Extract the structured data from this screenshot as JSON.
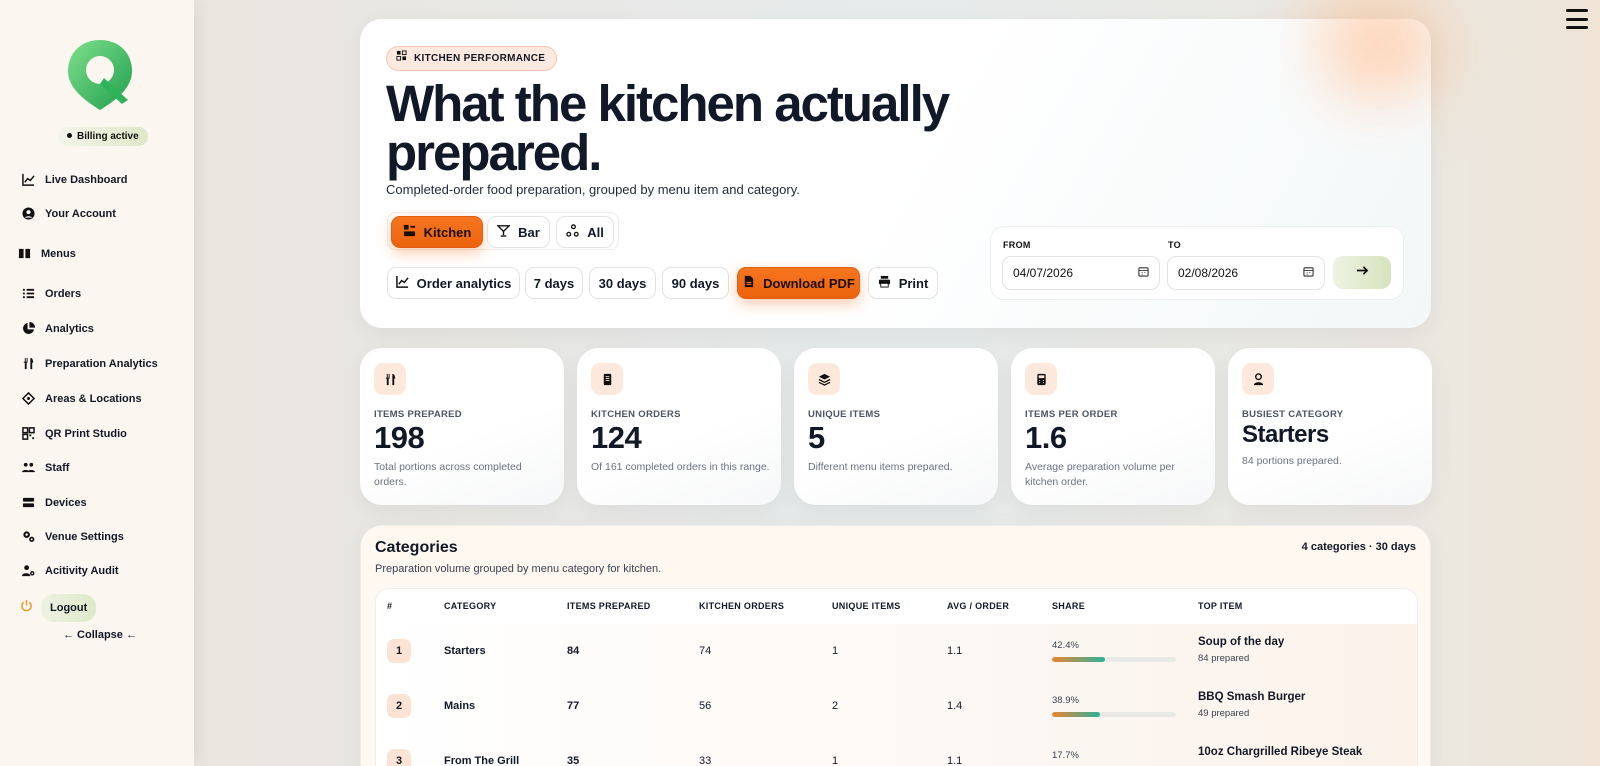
{
  "sidebar": {
    "billing": "Billing active",
    "items": [
      {
        "label": "Live Dashboard",
        "icon": "chart-line-icon"
      },
      {
        "label": "Your Account",
        "icon": "user-circle-icon"
      },
      {
        "label": "Menus",
        "icon": "book-icon"
      },
      {
        "label": "Orders",
        "icon": "list-icon"
      },
      {
        "label": "Analytics",
        "icon": "pie-chart-icon"
      },
      {
        "label": "Preparation Analytics",
        "icon": "utensils-icon"
      },
      {
        "label": "Areas & Locations",
        "icon": "location-diamond-icon"
      },
      {
        "label": "QR Print Studio",
        "icon": "qr-code-icon"
      },
      {
        "label": "Staff",
        "icon": "users-icon"
      },
      {
        "label": "Devices",
        "icon": "server-icon"
      },
      {
        "label": "Venue Settings",
        "icon": "gears-icon"
      },
      {
        "label": "Acitivity Audit",
        "icon": "user-gear-icon"
      }
    ],
    "logout": "Logout",
    "collapse": "← Collapse ←"
  },
  "hero": {
    "badge": "KITCHEN PERFORMANCE",
    "title": "What the kitchen actually prepared.",
    "subtitle": "Completed-order food preparation, grouped by menu item and category.",
    "toggles": [
      "Kitchen",
      "Bar",
      "All"
    ],
    "actions": {
      "order_analytics": "Order analytics",
      "d7": "7 days",
      "d30": "30 days",
      "d90": "90 days",
      "pdf": "Download PDF",
      "print": "Print"
    },
    "date": {
      "from_label": "FROM",
      "from_value": "04/07/2026",
      "to_label": "TO",
      "to_value": "02/08/2026"
    }
  },
  "stats": [
    {
      "label": "ITEMS PREPARED",
      "value": "198",
      "desc": "Total portions across completed orders.",
      "icon": "utensils-icon"
    },
    {
      "label": "KITCHEN ORDERS",
      "value": "124",
      "desc": "Of 161 completed orders in this range.",
      "icon": "receipt-icon"
    },
    {
      "label": "UNIQUE ITEMS",
      "value": "5",
      "desc": "Different menu items prepared.",
      "icon": "layers-icon"
    },
    {
      "label": "ITEMS PER ORDER",
      "value": "1.6",
      "desc": "Average preparation volume per kitchen order.",
      "icon": "calculator-icon"
    },
    {
      "label": "BUSIEST CATEGORY",
      "value": "Starters",
      "desc": "84 portions prepared.",
      "icon": "chef-icon"
    }
  ],
  "categories": {
    "title": "Categories",
    "subtitle": "Preparation volume grouped by menu category for kitchen.",
    "meta": "4 categories · 30 days",
    "headers": [
      "#",
      "CATEGORY",
      "ITEMS PREPARED",
      "KITCHEN ORDERS",
      "UNIQUE ITEMS",
      "AVG / ORDER",
      "SHARE",
      "TOP ITEM"
    ],
    "rows": [
      {
        "rank": "1",
        "category": "Starters",
        "items": "84",
        "orders": "74",
        "unique": "1",
        "avg": "1.1",
        "share": "42.4%",
        "share_value": 42.4,
        "top": "Soup of the day",
        "top_sub": "84 prepared"
      },
      {
        "rank": "2",
        "category": "Mains",
        "items": "77",
        "orders": "56",
        "unique": "2",
        "avg": "1.4",
        "share": "38.9%",
        "share_value": 38.9,
        "top": "BBQ Smash Burger",
        "top_sub": "49 prepared"
      },
      {
        "rank": "3",
        "category": "From The Grill",
        "items": "35",
        "orders": "33",
        "unique": "1",
        "avg": "1.1",
        "share": "17.7%",
        "share_value": 17.7,
        "top": "10oz Chargrilled Ribeye Steak",
        "top_sub": ""
      }
    ]
  },
  "colors": {
    "accent": "#f26b1d",
    "lime": "#d8e6c2",
    "ink": "#111827",
    "bar_start": "#e8852f",
    "bar_end": "#2bb29a"
  }
}
